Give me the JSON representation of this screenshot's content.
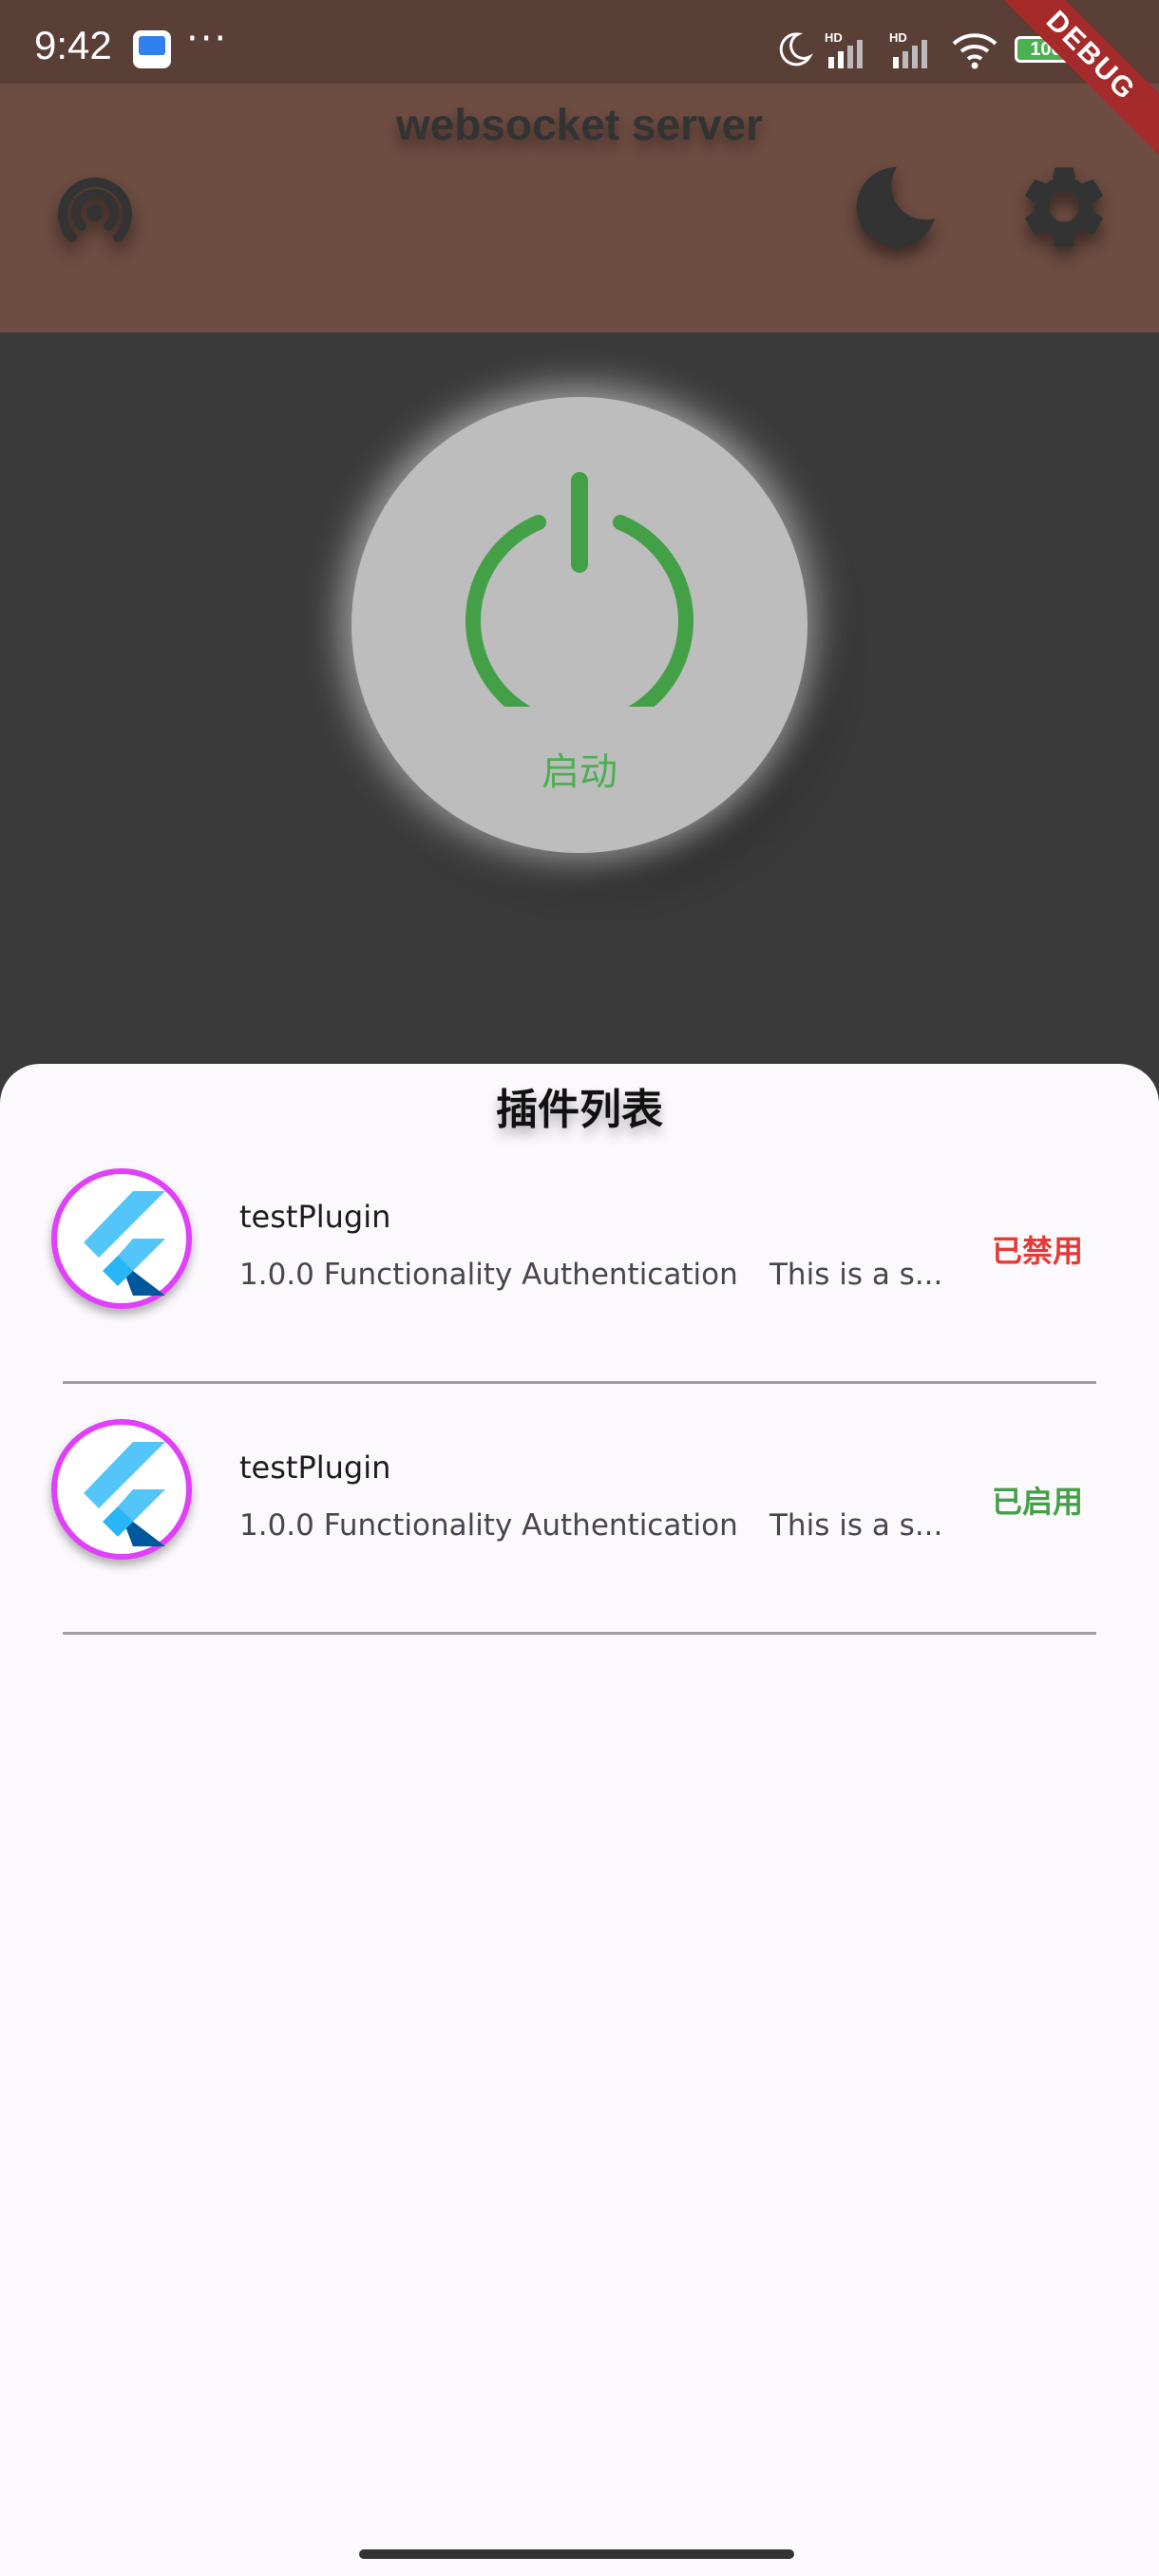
{
  "status_bar": {
    "time": "9:42",
    "dots": "···",
    "battery": "100",
    "debug_label": "DEBUG",
    "icons": [
      "app-notification-icon",
      "moon-icon",
      "signal-icon",
      "signal-icon",
      "wifi-icon",
      "battery-icon"
    ]
  },
  "app_bar": {
    "title": "websocket server",
    "icons": [
      "broadcast-icon",
      "dark-mode-icon",
      "settings-icon"
    ],
    "background": "#6d4c41"
  },
  "power_button": {
    "label": "启动",
    "color": "#4caf50"
  },
  "plugin_list": {
    "title": "插件列表",
    "items": [
      {
        "name": "testPlugin",
        "version_desc": "1.0.0 Functionality Authentication",
        "summary": "This is a s...",
        "status": "已禁用",
        "status_color": "#e53935"
      },
      {
        "name": "testPlugin",
        "version_desc": "1.0.0 Functionality Authentication",
        "summary": "This is a s...",
        "status": "已启用",
        "status_color": "#43a047"
      }
    ]
  }
}
